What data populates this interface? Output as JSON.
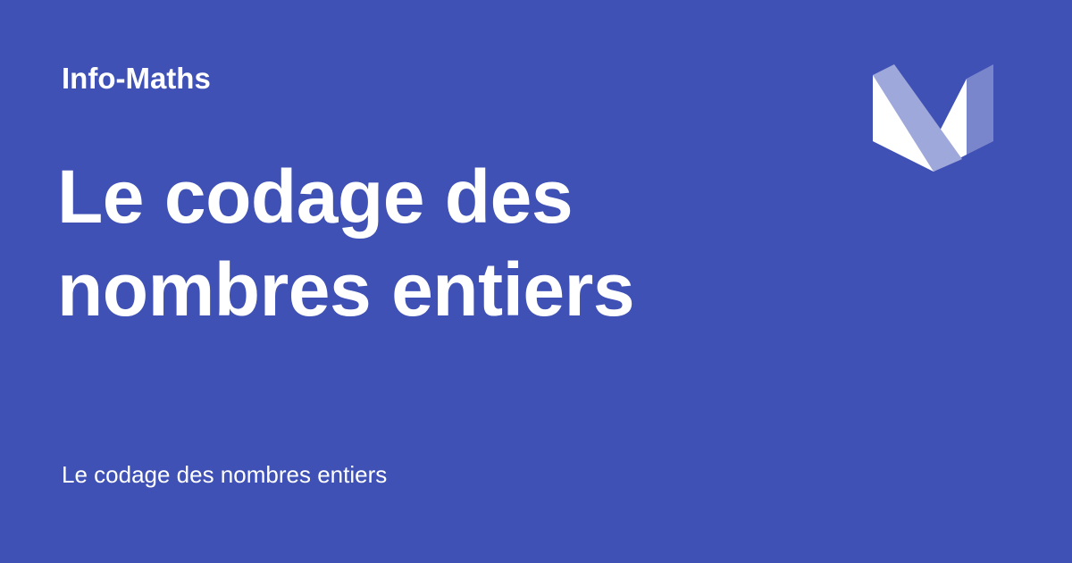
{
  "theme": {
    "background": "#3f51b5",
    "text": "#ffffff",
    "logo_light": "#ffffff",
    "logo_mid": "#9fa8da",
    "logo_dark": "#7986cb"
  },
  "card": {
    "site_name": "Info-Maths",
    "title": "Le codage des nombres entiers",
    "description": "Le codage des nombres entiers",
    "logo_icon": "material-logo-icon"
  }
}
